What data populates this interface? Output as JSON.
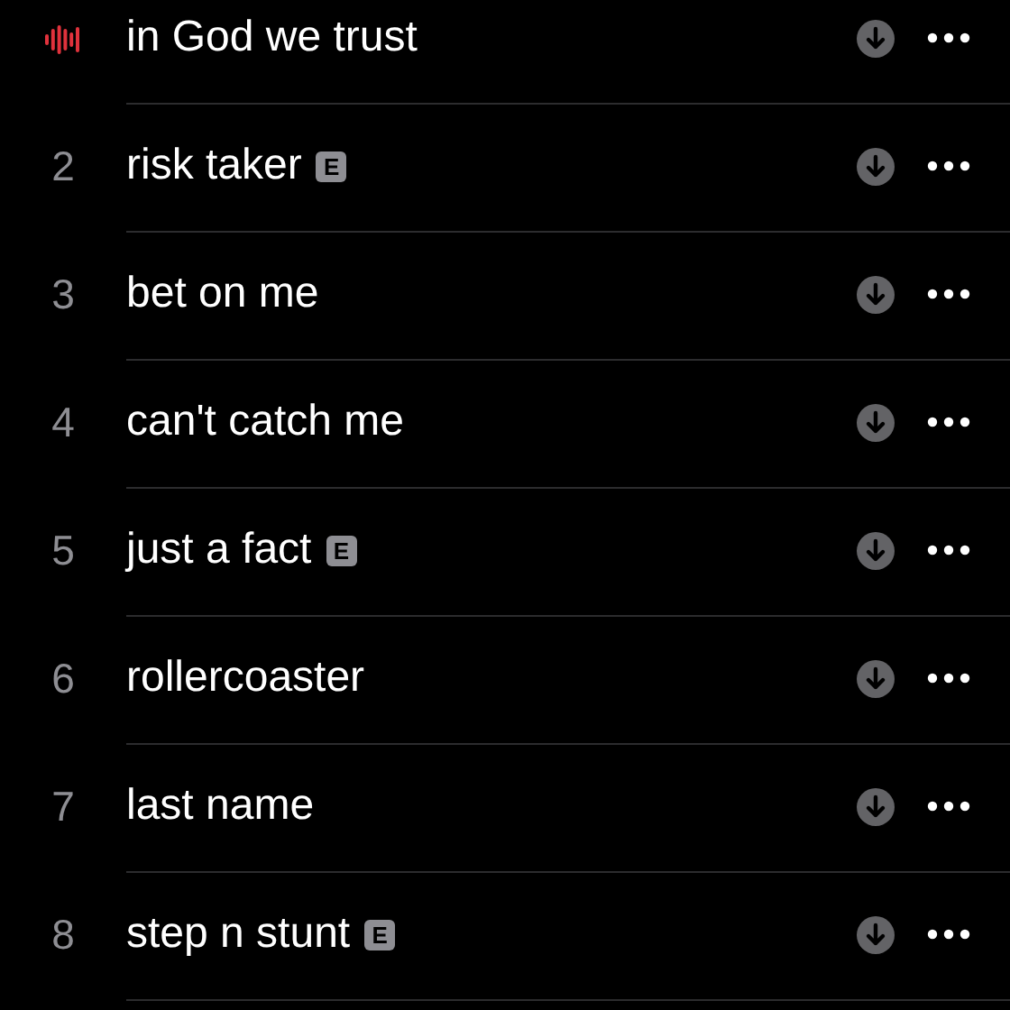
{
  "tracks": [
    {
      "playing": true,
      "title": "in God we trust"
    },
    {
      "playing": false,
      "number": "2",
      "title": "risk taker",
      "badge": "E"
    },
    {
      "playing": false,
      "number": "3",
      "title": "bet on me"
    },
    {
      "playing": false,
      "number": "4",
      "title": "can't catch me"
    },
    {
      "playing": false,
      "number": "5",
      "title": "just a fact",
      "badge": "E"
    },
    {
      "playing": false,
      "number": "6",
      "title": "rollercoaster"
    },
    {
      "playing": false,
      "number": "7",
      "title": "last name"
    },
    {
      "playing": false,
      "number": "8",
      "title": "step n stunt",
      "badge": "E"
    }
  ]
}
